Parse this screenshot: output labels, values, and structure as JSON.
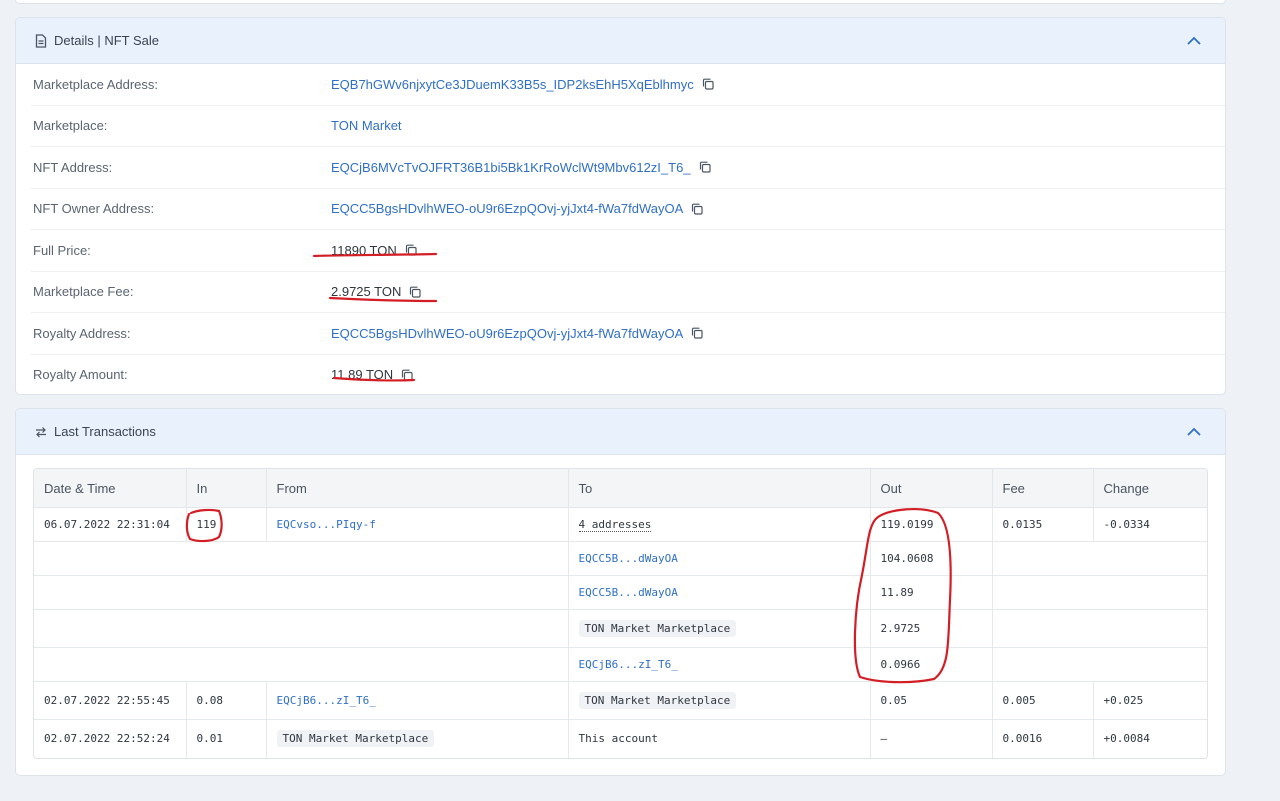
{
  "details": {
    "title": "Details | NFT Sale",
    "rows": [
      {
        "label": "Marketplace Address:",
        "value": "EQB7hGWv6njxytCe3JDuemK33B5s_IDP2ksEhH5XqEblhmyc",
        "link": true,
        "copy": true
      },
      {
        "label": "Marketplace:",
        "value": "TON Market",
        "link": true,
        "copy": false
      },
      {
        "label": "NFT Address:",
        "value": "EQCjB6MVcTvOJFRT36B1bi5Bk1KrRoWclWt9Mbv612zI_T6_",
        "link": true,
        "copy": true
      },
      {
        "label": "NFT Owner Address:",
        "value": "EQCC5BgsHDvlhWEO-oU9r6EzpQOvj-yjJxt4-fWa7fdWayOA",
        "link": true,
        "copy": true
      },
      {
        "label": "Full Price:",
        "value": "11890 TON",
        "link": false,
        "copy": true
      },
      {
        "label": "Marketplace Fee:",
        "value": "2.9725 TON",
        "link": false,
        "copy": true
      },
      {
        "label": "Royalty Address:",
        "value": "EQCC5BgsHDvlhWEO-oU9r6EzpQOvj-yjJxt4-fWa7fdWayOA",
        "link": true,
        "copy": true
      },
      {
        "label": "Royalty Amount:",
        "value": "11.89 TON",
        "link": false,
        "copy": true
      }
    ]
  },
  "transactions": {
    "title": "Last Transactions",
    "headers": [
      "Date & Time",
      "In",
      "From",
      "To",
      "Out",
      "Fee",
      "Change"
    ],
    "rows": [
      {
        "date": "06.07.2022 22:31:04",
        "in": "119",
        "from": "EQCvso...PIqy-f",
        "from_style": "link",
        "to": "4 addresses",
        "to_style": "dotted",
        "out": "119.0199",
        "fee": "0.0135",
        "change": "-0.0334"
      },
      {
        "date": "",
        "in": "",
        "from": "",
        "from_style": "",
        "to": "EQCC5B...dWayOA",
        "to_style": "link",
        "out": "104.0608",
        "fee": "",
        "change": ""
      },
      {
        "date": "",
        "in": "",
        "from": "",
        "from_style": "",
        "to": "EQCC5B...dWayOA",
        "to_style": "link",
        "out": "11.89",
        "fee": "",
        "change": ""
      },
      {
        "date": "",
        "in": "",
        "from": "",
        "from_style": "",
        "to": "TON Market Marketplace",
        "to_style": "pill",
        "out": "2.9725",
        "fee": "",
        "change": ""
      },
      {
        "date": "",
        "in": "",
        "from": "",
        "from_style": "",
        "to": "EQCjB6...zI_T6_",
        "to_style": "link",
        "out": "0.0966",
        "fee": "",
        "change": ""
      },
      {
        "date": "02.07.2022 22:55:45",
        "in": "0.08",
        "from": "EQCjB6...zI_T6_",
        "from_style": "link",
        "to": "TON Market Marketplace",
        "to_style": "pill",
        "out": "0.05",
        "fee": "0.005",
        "change": "+0.025"
      },
      {
        "date": "02.07.2022 22:52:24",
        "in": "0.01",
        "from": "TON Market Marketplace",
        "from_style": "pill",
        "to": "This account",
        "to_style": "plain",
        "out": "—",
        "fee": "0.0016",
        "change": "+0.0084"
      }
    ]
  },
  "colors": {
    "link": "#2f6fc6",
    "header_bg": "#e8f1fc",
    "annotation": "#d21e24"
  },
  "icons": [
    "document-icon",
    "swap-arrows-icon",
    "chevron-up-icon",
    "copy-icon"
  ]
}
